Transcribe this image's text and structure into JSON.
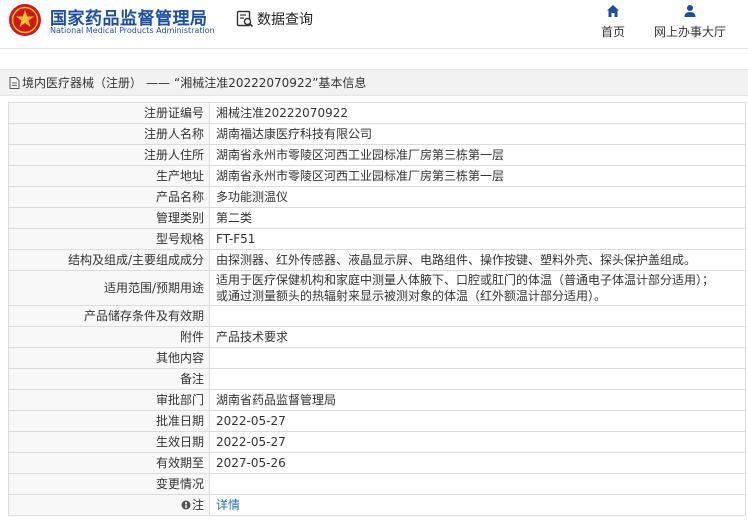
{
  "header": {
    "brand_cn": "国家药品监督管理局",
    "brand_en": "National Medical Products Administration",
    "data_query": "数据查询",
    "nav": [
      {
        "label": "首页",
        "icon": "home-icon"
      },
      {
        "label": "网上办事大厅",
        "icon": "user-icon"
      }
    ]
  },
  "breadcrumb": {
    "section": "境内医疗器械（注册）",
    "separator": "——",
    "current": "“湘械注准20222070922”基本信息"
  },
  "table": {
    "rows": [
      {
        "label": "注册证编号",
        "value": "湘械注准20222070922"
      },
      {
        "label": "注册人名称",
        "value": "湖南福达康医疗科技有限公司"
      },
      {
        "label": "注册人住所",
        "value": "湖南省永州市零陵区河西工业园标准厂房第三栋第一层"
      },
      {
        "label": "生产地址",
        "value": "湖南省永州市零陵区河西工业园标准厂房第三栋第一层"
      },
      {
        "label": "产品名称",
        "value": "多功能测温仪"
      },
      {
        "label": "管理类别",
        "value": "第二类"
      },
      {
        "label": "型号规格",
        "value": "FT-F51"
      },
      {
        "label": "结构及组成/主要组成成分",
        "value": "由探测器、红外传感器、液晶显示屏、电路组件、操作按键、塑料外壳、探头保护盖组成。"
      },
      {
        "label": "适用范围/预期用途",
        "value_line1": "适用于医疗保健机构和家庭中测量人体腋下、口腔或肛门的体温（普通电子体温计部分适用）；",
        "value_line2": "或通过测量额头的热辐射来显示被测对象的体温（红外额温计部分适用）。"
      },
      {
        "label": "产品储存条件及有效期",
        "value": ""
      },
      {
        "label": "附件",
        "value": "产品技术要求"
      },
      {
        "label": "其他内容",
        "value": ""
      },
      {
        "label": "备注",
        "value": ""
      },
      {
        "label": "审批部门",
        "value": "湖南省药品监督管理局"
      },
      {
        "label": "批准日期",
        "value": "2022-05-27"
      },
      {
        "label": "生效日期",
        "value": "2022-05-27"
      },
      {
        "label": "有效期至",
        "value": "2027-05-26"
      },
      {
        "label": "变更情况",
        "value": ""
      },
      {
        "label": "注",
        "value": "详情",
        "icon": "note-icon"
      }
    ]
  },
  "colors": {
    "brand_blue": "#1c4fa1",
    "link_blue": "#1c6fbf",
    "logo_red": "#d4161a",
    "logo_gold": "#f2c230"
  }
}
